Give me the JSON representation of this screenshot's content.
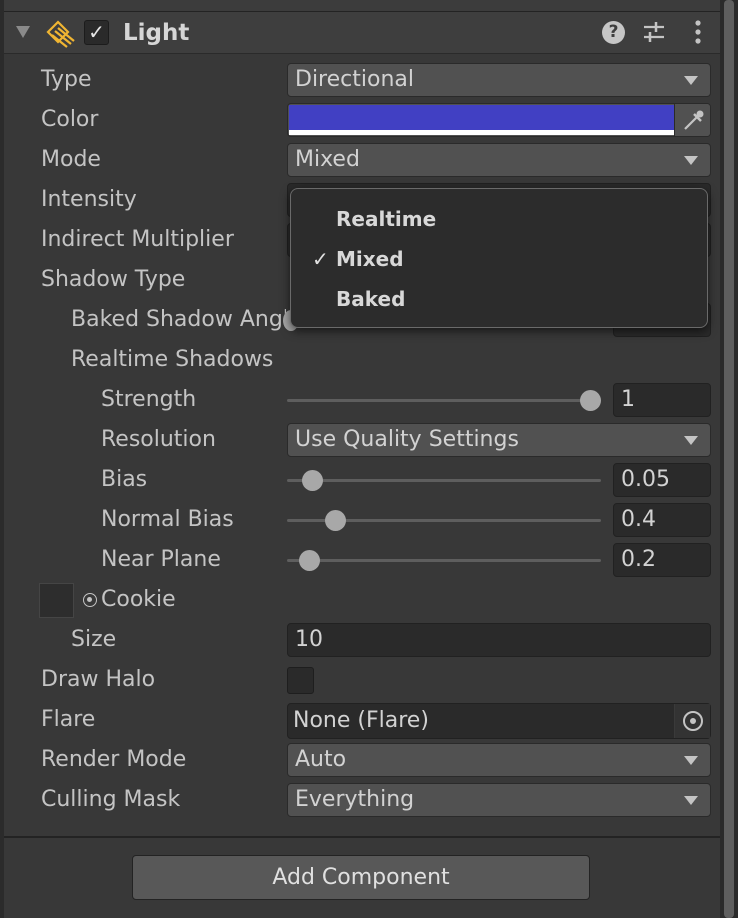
{
  "component": {
    "title": "Light",
    "enabled": true,
    "help_icon": "?"
  },
  "properties": {
    "type": {
      "label": "Type",
      "value": "Directional"
    },
    "color": {
      "label": "Color",
      "value_hex": "#4140c3"
    },
    "mode": {
      "label": "Mode",
      "value": "Mixed"
    },
    "intensity": {
      "label": "Intensity"
    },
    "indirect_multiplier": {
      "label": "Indirect Multiplier"
    },
    "shadow_type": {
      "label": "Shadow Type"
    },
    "baked_shadow_angle": {
      "label": "Baked Shadow Angle"
    },
    "realtime_shadows": {
      "label": "Realtime Shadows"
    },
    "strength": {
      "label": "Strength",
      "value": "1",
      "slider_fraction": 1.0
    },
    "resolution": {
      "label": "Resolution",
      "value": "Use Quality Settings"
    },
    "bias": {
      "label": "Bias",
      "value": "0.05",
      "slider_fraction": 0.05
    },
    "normal_bias": {
      "label": "Normal Bias",
      "value": "0.4",
      "slider_fraction": 0.13
    },
    "near_plane": {
      "label": "Near Plane",
      "value": "0.2",
      "slider_fraction": 0.04
    },
    "cookie": {
      "label": "Cookie"
    },
    "size": {
      "label": "Size",
      "value": "10"
    },
    "draw_halo": {
      "label": "Draw Halo",
      "checked": false
    },
    "flare": {
      "label": "Flare",
      "value": "None (Flare)"
    },
    "render_mode": {
      "label": "Render Mode",
      "value": "Auto"
    },
    "culling_mask": {
      "label": "Culling Mask",
      "value": "Everything"
    }
  },
  "mode_popup": {
    "items": [
      {
        "label": "Realtime",
        "selected": false
      },
      {
        "label": "Mixed",
        "selected": true,
        "check": "✓"
      },
      {
        "label": "Baked",
        "selected": false
      }
    ]
  },
  "footer": {
    "add_component_label": "Add Component"
  },
  "icons": {
    "foldout": "triangle-down-icon",
    "component": "directional-light-icon",
    "help": "help-icon",
    "presets": "presets-icon",
    "menu": "kebab-menu-icon",
    "picker": "eyedropper-icon",
    "object_target": "object-picker-icon"
  },
  "colors": {
    "panel_bg": "#383838",
    "swatch": "#4140c3",
    "accent_icon": "#f0b532"
  }
}
